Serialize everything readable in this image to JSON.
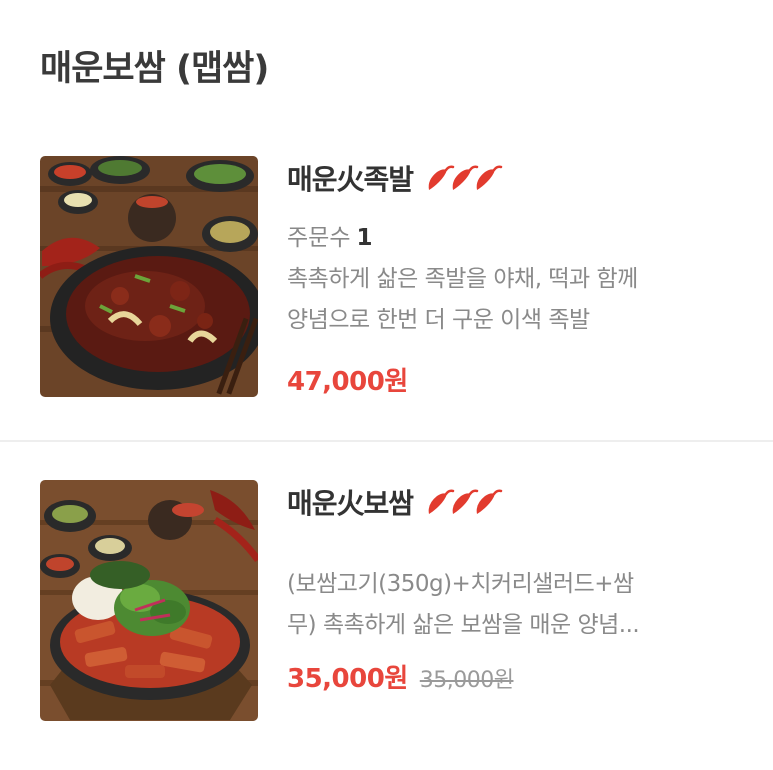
{
  "section": {
    "title": "매운보쌈 (맵쌈)"
  },
  "items": [
    {
      "name": "매운火족발",
      "spicy_level": 3,
      "spicy_icon": "chili-pepper-icon",
      "order_label": "주문수",
      "order_count": "1",
      "desc_line1": "촉촉하게 삶은 족발을 야채, 떡과 함께",
      "desc_line2": "양념으로 한번 더 구운 이색 족발",
      "price": "47,000원",
      "original_price": ""
    },
    {
      "name": "매운火보쌈",
      "spicy_level": 3,
      "spicy_icon": "chili-pepper-icon",
      "order_label": "",
      "order_count": "",
      "desc_line1": "(보쌈고기(350g)+치커리샐러드+쌈",
      "desc_line2": "무) 촉촉하게 삶은 보쌈을 매운 양념...",
      "price": "35,000원",
      "original_price": "35,000원"
    }
  ],
  "colors": {
    "price": "#e8463c",
    "chili": "#e23b2e",
    "muted": "#8a8a8a",
    "title": "#333333"
  }
}
